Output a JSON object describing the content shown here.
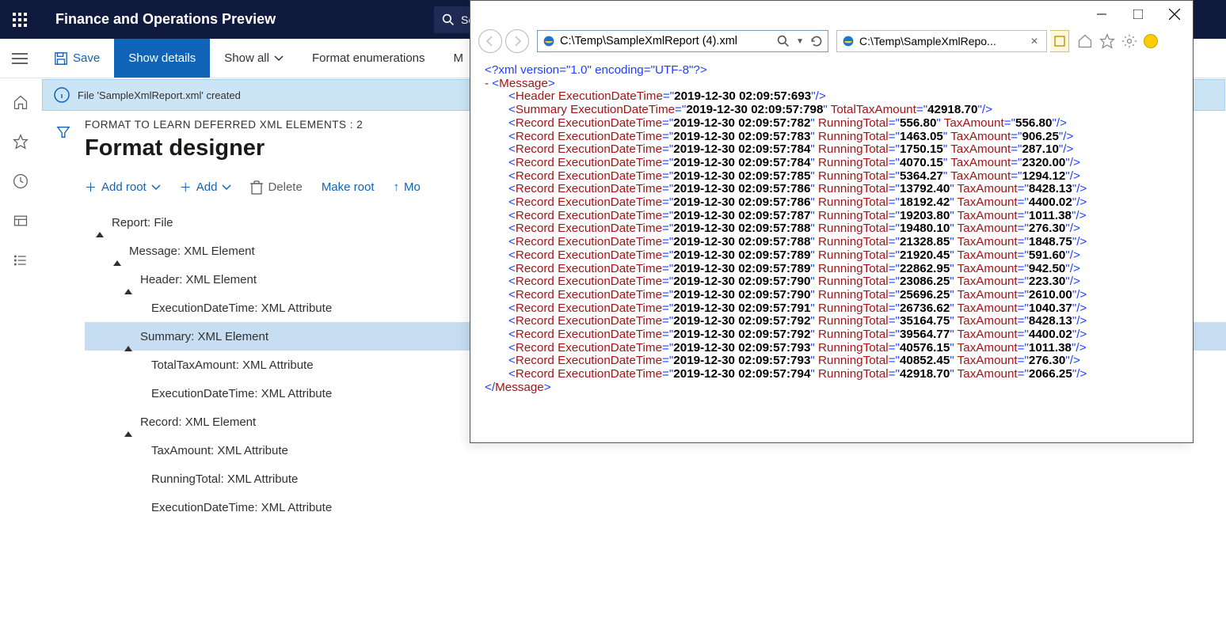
{
  "topbar": {
    "title": "Finance and Operations Preview",
    "search": "Search"
  },
  "cmd": {
    "save": "Save",
    "details": "Show details",
    "showall": "Show all",
    "enums": "Format enumerations",
    "more": "M"
  },
  "notice": "File 'SampleXmlReport.xml' created",
  "bc": "FORMAT TO LEARN DEFERRED XML ELEMENTS : 2",
  "h1": "Format designer",
  "tb": {
    "addroot": "Add root",
    "add": "Add",
    "del": "Delete",
    "mkroot": "Make root",
    "moveup": "Mo"
  },
  "tree": {
    "n0": "Report: File",
    "n1": "Message: XML Element",
    "n2": "Header: XML Element",
    "n3": "ExecutionDateTime: XML Attribute",
    "n4": "Summary: XML Element",
    "n5": "TotalTaxAmount: XML Attribute",
    "n6": "ExecutionDateTime: XML Attribute",
    "n7": "Record: XML Element",
    "n8": "TaxAmount: XML Attribute",
    "n9": "RunningTotal: XML Attribute",
    "n10": "ExecutionDateTime: XML Attribute"
  },
  "ie": {
    "addr": "C:\\Temp\\SampleXmlReport (4).xml",
    "tab": "C:\\Temp\\SampleXmlRepo..."
  },
  "xml": {
    "decl": "<?xml version=\"1.0\" encoding=\"UTF-8\"?>",
    "root": "Message",
    "header": {
      "ExecutionDateTime": "2019-12-30 02:09:57:693"
    },
    "summary": {
      "ExecutionDateTime": "2019-12-30 02:09:57:798",
      "TotalTaxAmount": "42918.70"
    },
    "records": [
      {
        "ExecutionDateTime": "2019-12-30 02:09:57:782",
        "RunningTotal": "556.80",
        "TaxAmount": "556.80"
      },
      {
        "ExecutionDateTime": "2019-12-30 02:09:57:783",
        "RunningTotal": "1463.05",
        "TaxAmount": "906.25"
      },
      {
        "ExecutionDateTime": "2019-12-30 02:09:57:784",
        "RunningTotal": "1750.15",
        "TaxAmount": "287.10"
      },
      {
        "ExecutionDateTime": "2019-12-30 02:09:57:784",
        "RunningTotal": "4070.15",
        "TaxAmount": "2320.00"
      },
      {
        "ExecutionDateTime": "2019-12-30 02:09:57:785",
        "RunningTotal": "5364.27",
        "TaxAmount": "1294.12"
      },
      {
        "ExecutionDateTime": "2019-12-30 02:09:57:786",
        "RunningTotal": "13792.40",
        "TaxAmount": "8428.13"
      },
      {
        "ExecutionDateTime": "2019-12-30 02:09:57:786",
        "RunningTotal": "18192.42",
        "TaxAmount": "4400.02"
      },
      {
        "ExecutionDateTime": "2019-12-30 02:09:57:787",
        "RunningTotal": "19203.80",
        "TaxAmount": "1011.38"
      },
      {
        "ExecutionDateTime": "2019-12-30 02:09:57:788",
        "RunningTotal": "19480.10",
        "TaxAmount": "276.30"
      },
      {
        "ExecutionDateTime": "2019-12-30 02:09:57:788",
        "RunningTotal": "21328.85",
        "TaxAmount": "1848.75"
      },
      {
        "ExecutionDateTime": "2019-12-30 02:09:57:789",
        "RunningTotal": "21920.45",
        "TaxAmount": "591.60"
      },
      {
        "ExecutionDateTime": "2019-12-30 02:09:57:789",
        "RunningTotal": "22862.95",
        "TaxAmount": "942.50"
      },
      {
        "ExecutionDateTime": "2019-12-30 02:09:57:790",
        "RunningTotal": "23086.25",
        "TaxAmount": "223.30"
      },
      {
        "ExecutionDateTime": "2019-12-30 02:09:57:790",
        "RunningTotal": "25696.25",
        "TaxAmount": "2610.00"
      },
      {
        "ExecutionDateTime": "2019-12-30 02:09:57:791",
        "RunningTotal": "26736.62",
        "TaxAmount": "1040.37"
      },
      {
        "ExecutionDateTime": "2019-12-30 02:09:57:792",
        "RunningTotal": "35164.75",
        "TaxAmount": "8428.13"
      },
      {
        "ExecutionDateTime": "2019-12-30 02:09:57:792",
        "RunningTotal": "39564.77",
        "TaxAmount": "4400.02"
      },
      {
        "ExecutionDateTime": "2019-12-30 02:09:57:793",
        "RunningTotal": "40576.15",
        "TaxAmount": "1011.38"
      },
      {
        "ExecutionDateTime": "2019-12-30 02:09:57:793",
        "RunningTotal": "40852.45",
        "TaxAmount": "276.30"
      },
      {
        "ExecutionDateTime": "2019-12-30 02:09:57:794",
        "RunningTotal": "42918.70",
        "TaxAmount": "2066.25"
      }
    ]
  }
}
